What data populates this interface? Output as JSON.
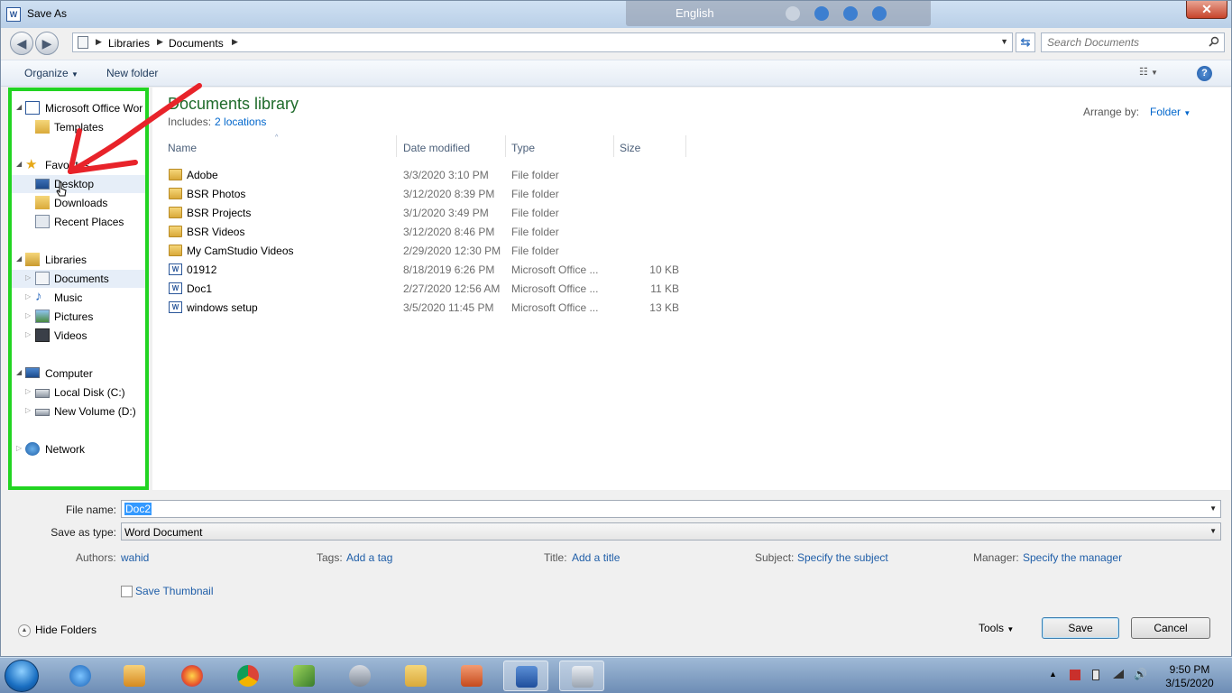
{
  "window": {
    "title": "Save As",
    "close_symbol": "✕"
  },
  "language_bar": {
    "label": "English"
  },
  "address": {
    "breadcrumb": [
      "Libraries",
      "Documents"
    ],
    "search_placeholder": "Search Documents"
  },
  "toolbar": {
    "organize": "Organize",
    "new_folder": "New folder",
    "help": "?"
  },
  "nav": {
    "items": [
      {
        "label": "Microsoft Office Wor"
      },
      {
        "label": "Templates"
      },
      {
        "label": "Favorites"
      },
      {
        "label": "Desktop"
      },
      {
        "label": "Downloads"
      },
      {
        "label": "Recent Places"
      },
      {
        "label": "Libraries"
      },
      {
        "label": "Documents"
      },
      {
        "label": "Music"
      },
      {
        "label": "Pictures"
      },
      {
        "label": "Videos"
      },
      {
        "label": "Computer"
      },
      {
        "label": "Local Disk (C:)"
      },
      {
        "label": "New Volume (D:)"
      },
      {
        "label": "Network"
      }
    ]
  },
  "main": {
    "title": "Documents library",
    "includes_label": "Includes:",
    "includes_link": "2 locations",
    "arrange_label": "Arrange by:",
    "arrange_value": "Folder",
    "columns": [
      "Name",
      "Date modified",
      "Type",
      "Size"
    ],
    "files": [
      {
        "name": "Adobe",
        "date": "3/3/2020 3:10 PM",
        "type": "File folder",
        "size": "",
        "kind": "folder"
      },
      {
        "name": "BSR Photos",
        "date": "3/12/2020 8:39 PM",
        "type": "File folder",
        "size": "",
        "kind": "folder"
      },
      {
        "name": "BSR Projects",
        "date": "3/1/2020 3:49 PM",
        "type": "File folder",
        "size": "",
        "kind": "folder"
      },
      {
        "name": "BSR Videos",
        "date": "3/12/2020 8:46 PM",
        "type": "File folder",
        "size": "",
        "kind": "folder"
      },
      {
        "name": "My CamStudio Videos",
        "date": "2/29/2020 12:30 PM",
        "type": "File folder",
        "size": "",
        "kind": "folder"
      },
      {
        "name": "01912",
        "date": "8/18/2019 6:26 PM",
        "type": "Microsoft Office ...",
        "size": "10 KB",
        "kind": "doc"
      },
      {
        "name": "Doc1",
        "date": "2/27/2020 12:56 AM",
        "type": "Microsoft Office ...",
        "size": "11 KB",
        "kind": "doc"
      },
      {
        "name": "windows setup",
        "date": "3/5/2020 11:45 PM",
        "type": "Microsoft Office ...",
        "size": "13 KB",
        "kind": "doc"
      }
    ]
  },
  "form": {
    "file_name_label": "File name:",
    "file_name_value": "Doc2",
    "save_type_label": "Save as type:",
    "save_type_value": "Word Document",
    "authors_label": "Authors:",
    "authors_value": "wahid",
    "tags_label": "Tags:",
    "tags_value": "Add a tag",
    "title_label": "Title:",
    "title_value": "Add a title",
    "subject_label": "Subject:",
    "subject_value": "Specify the subject",
    "manager_label": "Manager:",
    "manager_value": "Specify the manager",
    "thumbnail_label": "Save Thumbnail",
    "thumbnail_checked": false
  },
  "footer": {
    "hide_folders": "Hide Folders",
    "tools": "Tools",
    "save": "Save",
    "cancel": "Cancel"
  },
  "taskbar": {
    "time": "9:50 PM",
    "date": "3/15/2020"
  },
  "colors": {
    "highlight_box": "#22d422",
    "annotation_arrow": "#e8232a",
    "library_title": "#1f6b2b",
    "link": "#1f5ea8"
  }
}
